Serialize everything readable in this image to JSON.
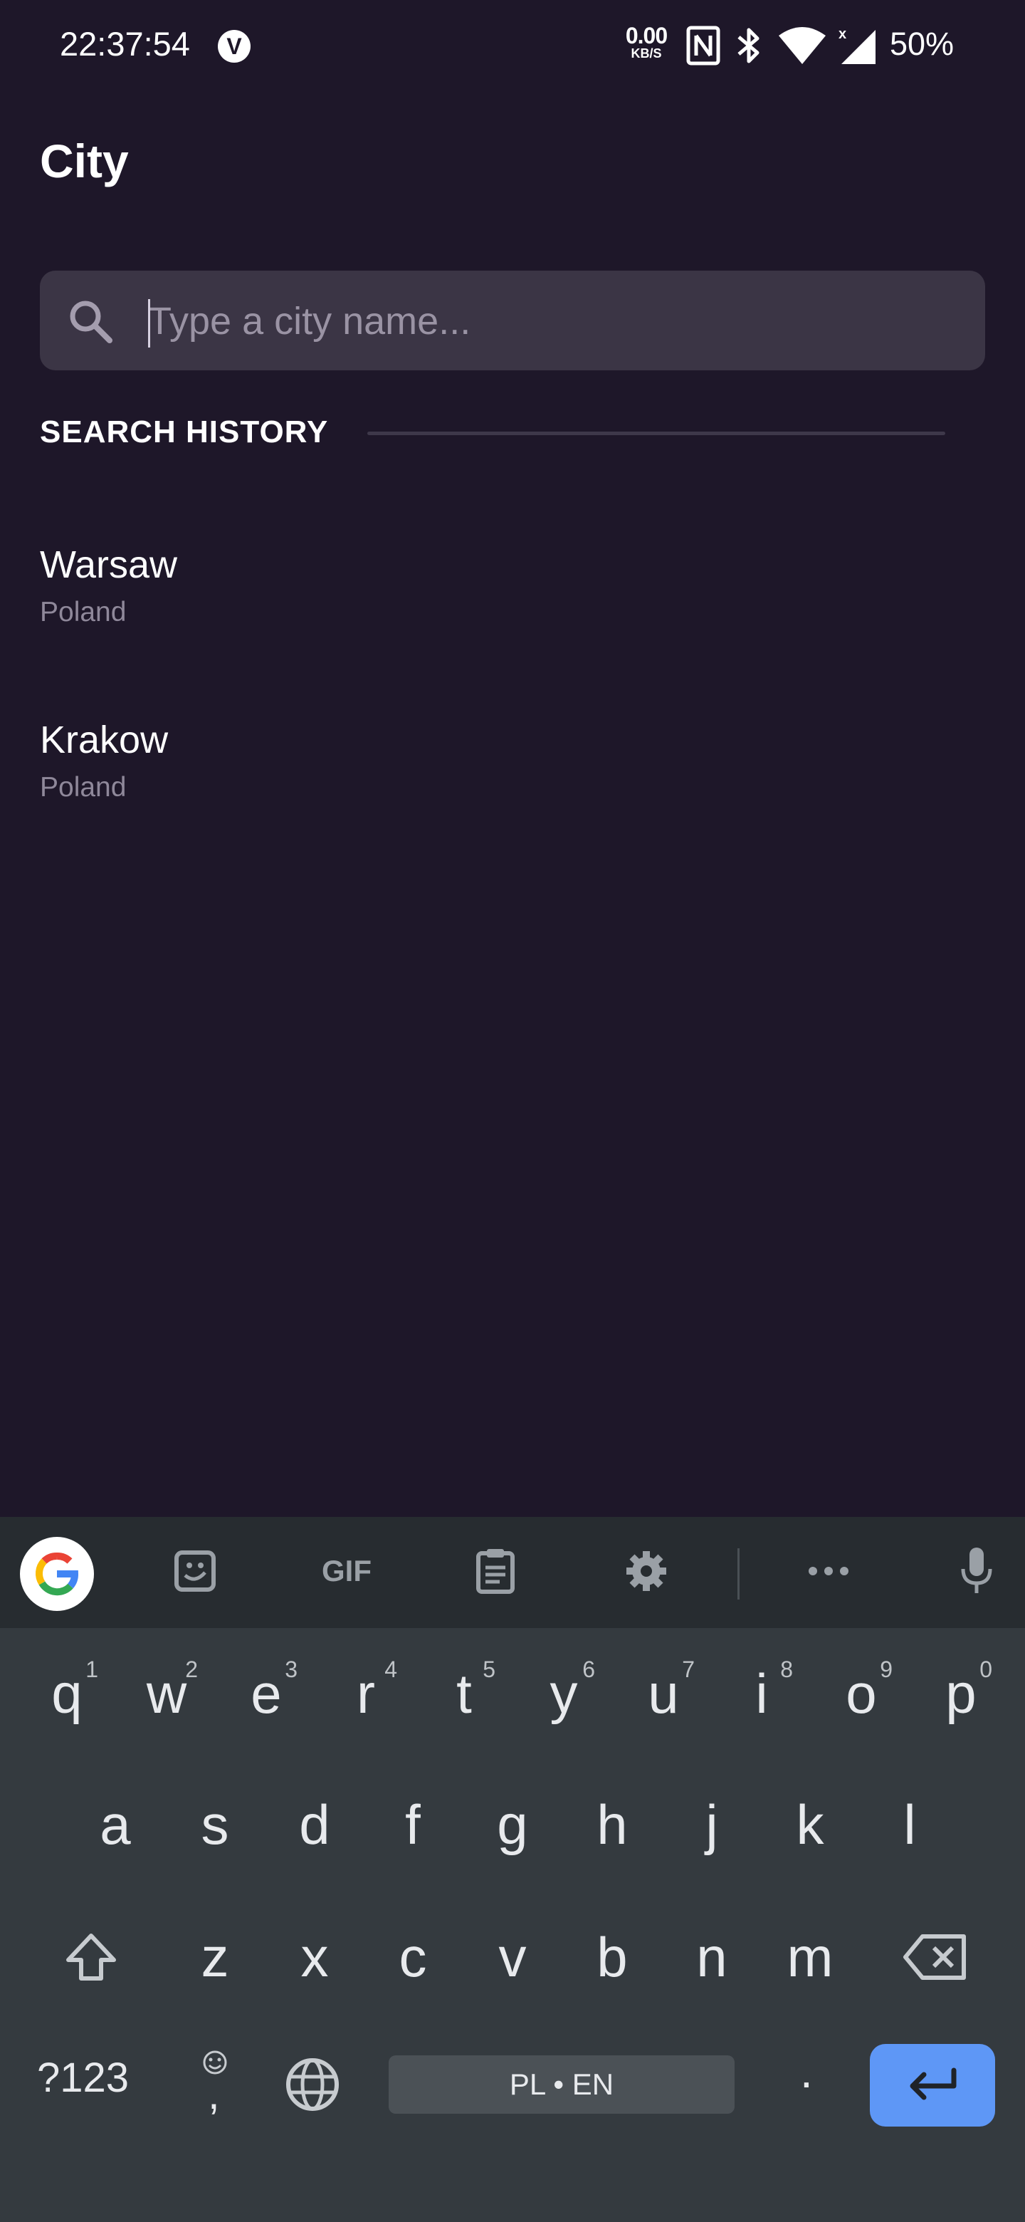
{
  "status_bar": {
    "time": "22:37:54",
    "app_badge": "V",
    "net_speed_value": "0.00",
    "net_speed_unit": "KB/S",
    "battery": "50%",
    "icons": [
      "nfc-icon",
      "bluetooth-icon",
      "wifi-icon",
      "signal-icon"
    ]
  },
  "header": {
    "title": "City"
  },
  "search": {
    "placeholder": "Type a city name...",
    "value": ""
  },
  "history": {
    "label": "SEARCH HISTORY",
    "items": [
      {
        "city": "Warsaw",
        "country": "Poland"
      },
      {
        "city": "Krakow",
        "country": "Poland"
      }
    ]
  },
  "keyboard": {
    "toolbar_icons": [
      "google-icon",
      "sticker-icon",
      "gif-icon",
      "clipboard-icon",
      "settings-icon",
      "more-icon",
      "mic-icon"
    ],
    "gif_label": "GIF",
    "row1": [
      "q",
      "w",
      "e",
      "r",
      "t",
      "y",
      "u",
      "i",
      "o",
      "p"
    ],
    "row1_nums": [
      "1",
      "2",
      "3",
      "4",
      "5",
      "6",
      "7",
      "8",
      "9",
      "0"
    ],
    "row2": [
      "a",
      "s",
      "d",
      "f",
      "g",
      "h",
      "j",
      "k",
      "l"
    ],
    "row3": [
      "z",
      "x",
      "c",
      "v",
      "b",
      "n",
      "m"
    ],
    "symbols_label": "?123",
    "emoji_key": ",",
    "space_label": "PL • EN",
    "period_label": ".",
    "accent_color": "#5e97f6"
  }
}
